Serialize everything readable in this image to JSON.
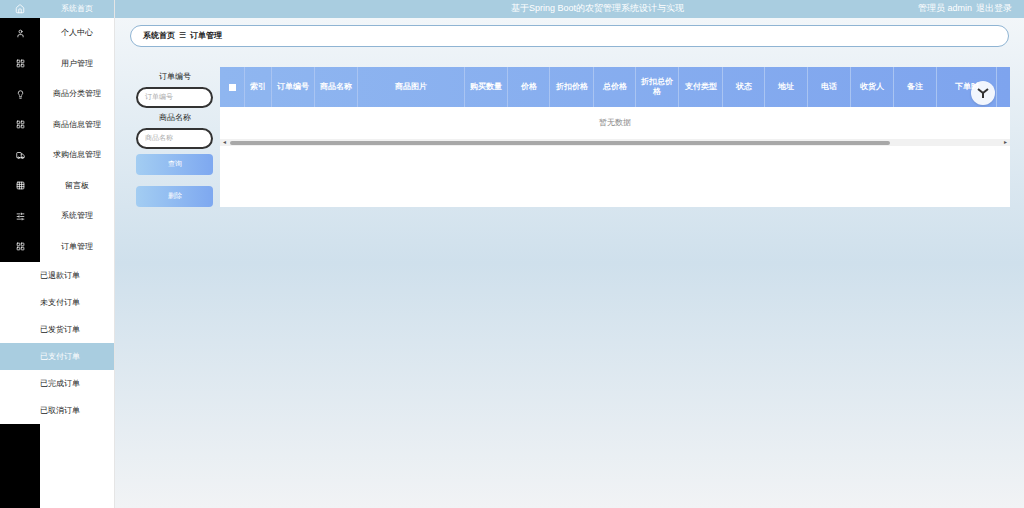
{
  "header": {
    "title": "基于Spring Boot的农贸管理系统设计与实现",
    "user": "管理员 admin",
    "logout": "退出登录"
  },
  "sidebar": {
    "items": [
      {
        "label": "系统首页",
        "selected": false
      },
      {
        "label": "个人中心",
        "selected": false
      },
      {
        "label": "用户管理",
        "selected": false
      },
      {
        "label": "商品分类管理",
        "selected": false
      },
      {
        "label": "商品信息管理",
        "selected": false
      },
      {
        "label": "求购信息管理",
        "selected": false
      },
      {
        "label": "留言板",
        "selected": false
      },
      {
        "label": "系统管理",
        "selected": false
      },
      {
        "label": "订单管理",
        "selected": false,
        "expanded": true
      }
    ],
    "subitems": [
      {
        "label": "已退款订单",
        "selected": false
      },
      {
        "label": "未支付订单",
        "selected": false
      },
      {
        "label": "已发货订单",
        "selected": false
      },
      {
        "label": "已支付订单",
        "selected": true
      },
      {
        "label": "已完成订单",
        "selected": false
      },
      {
        "label": "已取消订单",
        "selected": false
      }
    ]
  },
  "breadcrumb": {
    "home": "系统首页",
    "separator": "☰",
    "current": "订单管理"
  },
  "search": {
    "fields": [
      {
        "label": "订单编号",
        "placeholder": "订单编号"
      },
      {
        "label": "商品名称",
        "placeholder": "商品名称"
      }
    ],
    "buttons": [
      "查询",
      "删除"
    ]
  },
  "table": {
    "select_all": {
      "checked": false
    },
    "columns": [
      "索引",
      "订单编号",
      "商品名称",
      "商品图片",
      "购买数量",
      "价格",
      "折扣价格",
      "总价格",
      "折扣总价格",
      "支付类型",
      "状态",
      "地址",
      "电话",
      "收货人",
      "备注",
      "下单时"
    ],
    "rows": [],
    "empty": "暂无数据"
  }
}
